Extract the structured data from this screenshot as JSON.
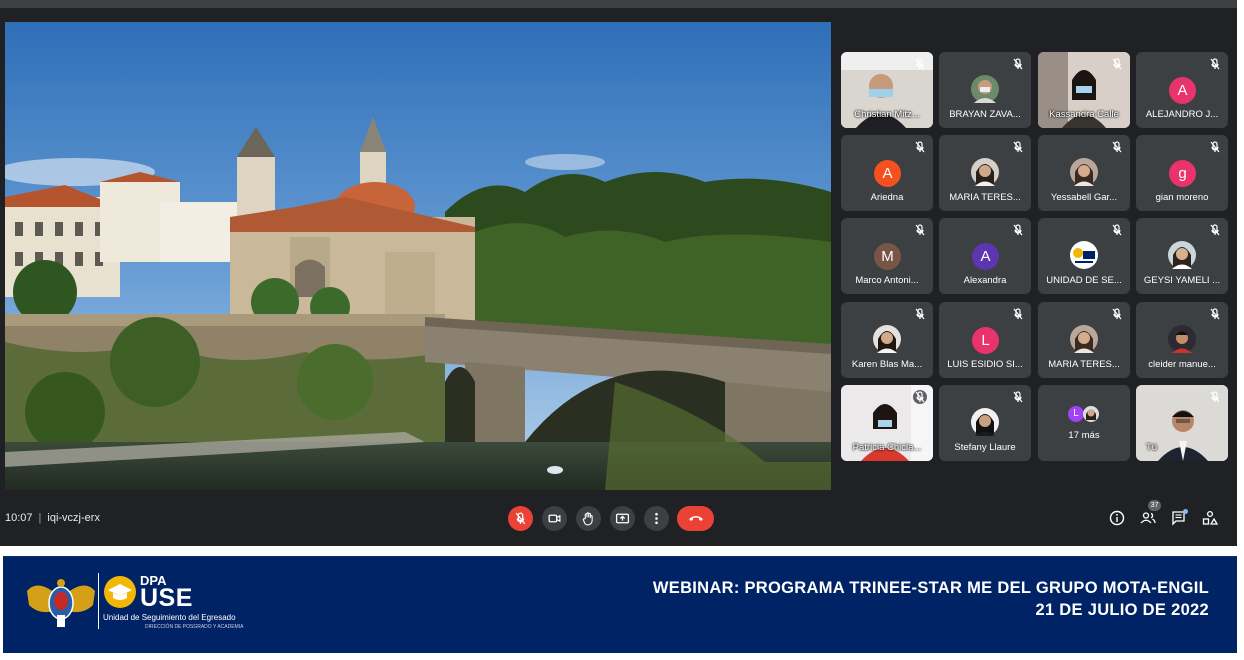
{
  "meeting": {
    "time": "10:07",
    "separator": "|",
    "code": "iqi-vczj-erx",
    "people_count": "37"
  },
  "participants": [
    {
      "name": "Christian Mitz...",
      "type": "video"
    },
    {
      "name": "BRAYAN ZAVA...",
      "type": "photo"
    },
    {
      "name": "Kassandra Calle",
      "type": "video"
    },
    {
      "name": "ALEJANDRO J...",
      "type": "letter",
      "letter": "A",
      "color": "#e8336d"
    },
    {
      "name": "Ariedna",
      "type": "letter",
      "letter": "A",
      "color": "#f4511e"
    },
    {
      "name": "MARIA TERES...",
      "type": "photo"
    },
    {
      "name": "Yessabell Gar...",
      "type": "photo"
    },
    {
      "name": "gian moreno",
      "type": "letter",
      "letter": "g",
      "color": "#e8336d"
    },
    {
      "name": "Marco Antoni...",
      "type": "letter",
      "letter": "M",
      "color": "#795548"
    },
    {
      "name": "Alexandra",
      "type": "letter",
      "letter": "A",
      "color": "#5e35b1"
    },
    {
      "name": "UNIDAD DE SE...",
      "type": "logo"
    },
    {
      "name": "GEYSI YAMELI ...",
      "type": "photo"
    },
    {
      "name": "Karen Blas Ma...",
      "type": "photo"
    },
    {
      "name": "LUIS ESIDIO SI...",
      "type": "letter",
      "letter": "L",
      "color": "#e8336d"
    },
    {
      "name": "MARIA TERES...",
      "type": "photo"
    },
    {
      "name": "cleider manue...",
      "type": "photo"
    },
    {
      "name": "Patricia Chicla...",
      "type": "video"
    },
    {
      "name": "Stefany Llaure",
      "type": "photo"
    },
    {
      "name": "17 más",
      "type": "more",
      "letter": "L",
      "color": "#a142f4"
    },
    {
      "name": "Tú",
      "type": "video"
    }
  ],
  "banner": {
    "title": "WEBINAR: PROGRAMA TRINEE-STAR ME DEL GRUPO MOTA-ENGIL",
    "date": "21 DE JULIO DE 2022",
    "logo_dpa": "DPA",
    "logo_use": "USE",
    "logo_subtitle": "Unidad de Seguimiento del Egresado",
    "logo_tiny": "DIRECCIÓN DE POSGRADO Y ACADEMIA"
  },
  "colors": {
    "meet_bg": "#202124",
    "tile_bg": "#3c4043",
    "end_call": "#ea4335",
    "banner_bg": "#002366"
  },
  "icons": [
    "mic-off-icon",
    "camera-icon",
    "raise-hand-icon",
    "present-icon",
    "more-options-icon",
    "end-call-icon",
    "info-icon",
    "people-icon",
    "chat-icon",
    "activities-icon"
  ]
}
